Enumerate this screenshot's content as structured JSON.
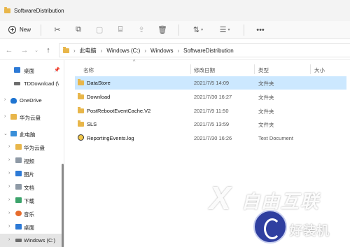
{
  "window": {
    "title": "SoftwareDistribution"
  },
  "toolbar": {
    "new_label": "New",
    "icons": [
      "cut-icon",
      "copy-icon",
      "paste-icon",
      "rename-icon",
      "share-icon",
      "delete-icon",
      "sort-icon",
      "view-icon",
      "more-icon"
    ]
  },
  "address": {
    "crumbs": [
      "此电脑",
      "Windows (C:)",
      "Windows",
      "SoftwareDistribution"
    ]
  },
  "sidebar": {
    "items": [
      {
        "label": "桌面",
        "icon": "desktop-icon",
        "pinned": true
      },
      {
        "label": "TDDownload (\\",
        "icon": "drive-icon"
      },
      {
        "label": "OneDrive",
        "icon": "onedrive-icon",
        "expandable": true
      },
      {
        "label": "华为云盘",
        "icon": "folder-icon",
        "expandable": true
      },
      {
        "label": "此电脑",
        "icon": "pc-icon",
        "expanded": true
      },
      {
        "label": "华为云盘",
        "icon": "folder-icon",
        "expandable": true
      },
      {
        "label": "视频",
        "icon": "video-icon",
        "expandable": true
      },
      {
        "label": "图片",
        "icon": "pictures-icon",
        "expandable": true
      },
      {
        "label": "文档",
        "icon": "documents-icon",
        "expandable": true
      },
      {
        "label": "下载",
        "icon": "downloads-icon",
        "expandable": true
      },
      {
        "label": "音乐",
        "icon": "music-icon",
        "expandable": true
      },
      {
        "label": "桌面",
        "icon": "desktop-icon",
        "expandable": true
      },
      {
        "label": "Windows (C:)",
        "icon": "drive-c-icon",
        "expandable": true,
        "selected": true
      }
    ]
  },
  "columns": {
    "name": "名称",
    "date": "修改日期",
    "type": "类型",
    "size": "大小"
  },
  "files": [
    {
      "name": "DataStore",
      "date": "2021/7/5 14:09",
      "type": "文件夹",
      "size": "",
      "kind": "folder",
      "selected": true
    },
    {
      "name": "Download",
      "date": "2021/7/30 16:27",
      "type": "文件夹",
      "size": "",
      "kind": "folder"
    },
    {
      "name": "PostRebootEventCache.V2",
      "date": "2021/7/9 11:50",
      "type": "文件夹",
      "size": "",
      "kind": "folder"
    },
    {
      "name": "SLS",
      "date": "2021/7/5 13:59",
      "type": "文件夹",
      "size": "",
      "kind": "folder"
    },
    {
      "name": "ReportingEvents.log",
      "date": "2021/7/30 16:26",
      "type": "Text Document",
      "size": "",
      "kind": "log"
    }
  ],
  "watermark": {
    "mark": "X",
    "text": "自由互联",
    "text2": "好装机"
  },
  "colors": {
    "selection": "#cce8ff",
    "folder": "#e8b64a",
    "accent": "#2d7ad6"
  }
}
